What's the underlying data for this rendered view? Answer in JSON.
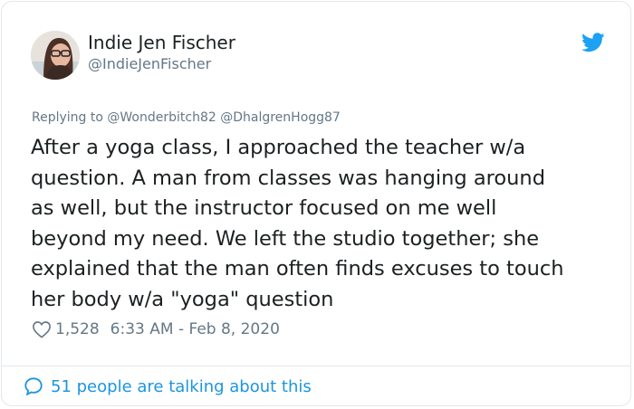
{
  "tweet": {
    "author_name": "Indie Jen Fischer",
    "author_handle": "@IndieJenFischer",
    "replying_prefix": "Replying to",
    "replying_to": [
      "@Wonderbitch82",
      "@DhalgrenHogg87"
    ],
    "text_lines": [
      "After a yoga class, I approached the teacher w/a",
      "question. A man from classes was hanging around",
      "as well, but the instructor focused on me well",
      "beyond my need. We left the studio together; she",
      "explained that the man often finds excuses to touch",
      "her body w/a \"yoga\" question"
    ],
    "likes": "1,528",
    "timestamp": "6:33 AM - Feb 8, 2020",
    "talking": "51 people are talking about this"
  },
  "colors": {
    "text": "#1c2022",
    "secondary": "#657786",
    "link": "#1b95e0",
    "twitter_blue": "#1da1f2",
    "border": "#e1e8ed"
  },
  "icons": {
    "brand": "twitter-bird-icon",
    "like": "heart-icon",
    "reply": "speech-bubble-icon"
  }
}
